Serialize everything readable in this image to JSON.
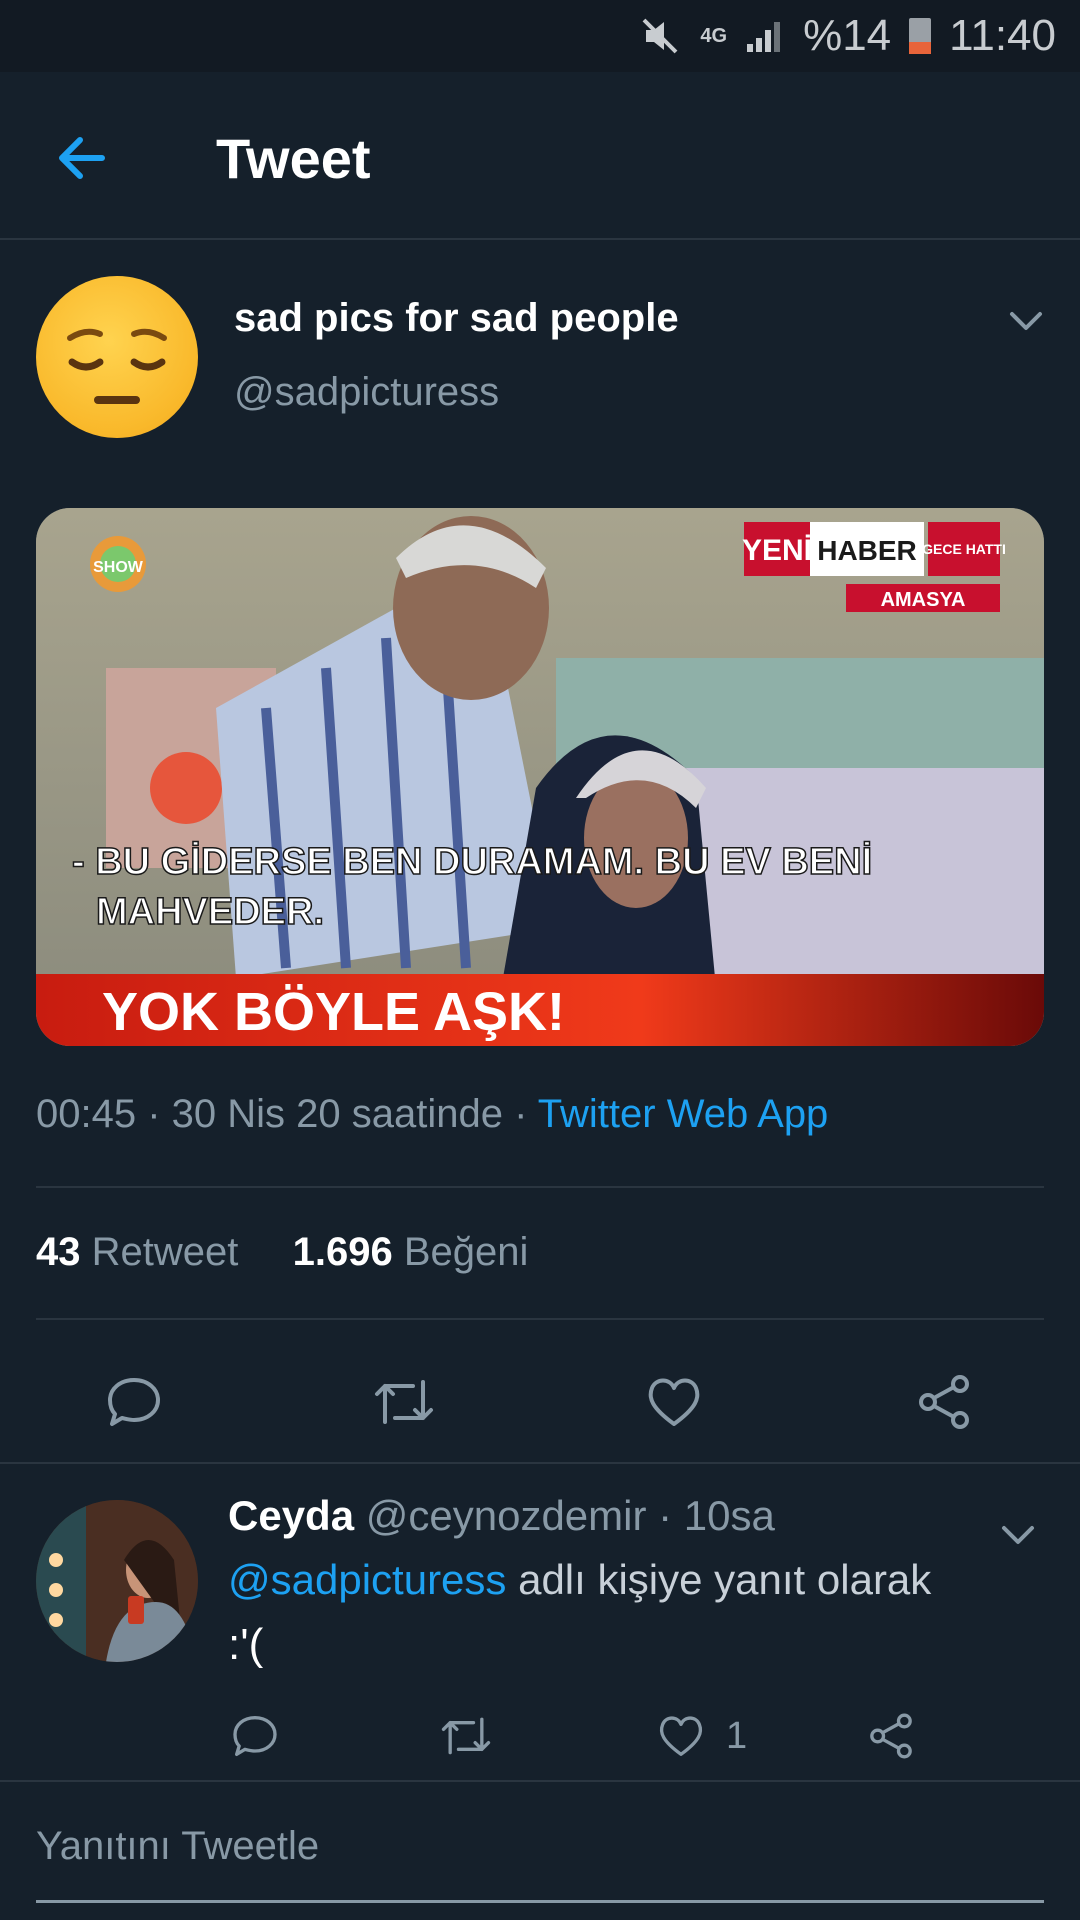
{
  "status_bar": {
    "network": "4G",
    "battery": "%14",
    "time": "11:40"
  },
  "header": {
    "title": "Tweet"
  },
  "tweet": {
    "author_name": "sad pics for sad people",
    "author_handle": "@sadpicturess",
    "media": {
      "logo_left": "SHOW",
      "channel_logo_1": "YENİ",
      "channel_logo_2": "HABER",
      "channel_logo_3": "GECE HATTI",
      "location": "AMASYA",
      "subtitle_line1": "- BU GİDERSE BEN DURAMAM. BU EV BENİ",
      "subtitle_line2": "MAHVEDER.",
      "banner": "YOK BÖYLE AŞK!"
    },
    "timestamp": "00:45 · 30 Nis 20 saatinde · ",
    "source": "Twitter Web App",
    "retweet_count": "43",
    "retweet_label": "Retweet",
    "like_count": "1.696",
    "like_label": "Beğeni"
  },
  "reply": {
    "name": "Ceyda",
    "handle_time": "@ceynozdemir · 10sa",
    "mention": "@sadpicturess",
    "reply_context": "adlı kişiye yanıt olarak",
    "text": ":'(",
    "like_count": "1"
  },
  "composer": {
    "placeholder": "Yanıtını Tweetle"
  },
  "colors": {
    "background": "#15202b",
    "accent": "#1da1f2",
    "secondary_text": "#8899a6"
  }
}
